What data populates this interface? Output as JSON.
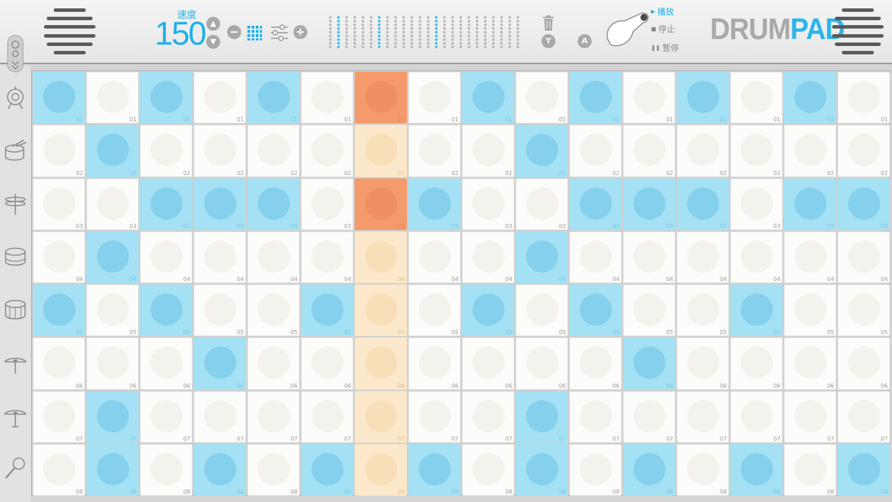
{
  "header": {
    "tempo_label": "速度",
    "tempo_value": "150",
    "tempo_up_icon": "▲",
    "tempo_down_icon": "▼",
    "minus_icon": "−",
    "plus_icon": "+",
    "y_label": "Y",
    "a_label": "A",
    "transport": {
      "play": "播放",
      "stop": "停止",
      "pause": "暂停",
      "active": "play"
    },
    "logo": {
      "part1": "DRUM",
      "part2": "PAD"
    }
  },
  "icons": {
    "left_speaker": "speaker-grille-icon",
    "right_speaker": "speaker-grille-icon",
    "pattern": "grid-icon",
    "mixer": "sliders-icon",
    "level_meter": "level-meter-icon",
    "trash": "trash-icon",
    "lever": "joystick-lever-icon",
    "kit_toggle": "kit-toggle-icon"
  },
  "colors": {
    "accent": "#1fb1ea",
    "active_pad": "#a4e1f5",
    "active_pad_dot": "#85d0ec",
    "playhead_pad": "#fce8cb",
    "playhead_active_pad": "#f49a6b",
    "idle_pad": "#fcfcfa",
    "logo_gray": "#a9a9a9"
  },
  "sequencer": {
    "steps": 16,
    "current_step": 7,
    "tracks": [
      {
        "icon": "gong-icon",
        "label": "01",
        "steps": [
          1,
          0,
          1,
          0,
          1,
          0,
          1,
          0,
          1,
          0,
          1,
          0,
          1,
          0,
          1,
          0
        ]
      },
      {
        "icon": "snare-drum-icon",
        "label": "02",
        "steps": [
          0,
          1,
          0,
          0,
          0,
          0,
          0,
          0,
          0,
          1,
          0,
          0,
          0,
          0,
          0,
          0
        ]
      },
      {
        "icon": "hihat-icon",
        "label": "03",
        "steps": [
          0,
          0,
          1,
          1,
          1,
          0,
          1,
          1,
          0,
          0,
          1,
          1,
          1,
          0,
          1,
          1
        ]
      },
      {
        "icon": "tom-drum-icon",
        "label": "04",
        "steps": [
          0,
          1,
          0,
          0,
          0,
          0,
          0,
          0,
          0,
          1,
          0,
          0,
          0,
          0,
          0,
          0
        ]
      },
      {
        "icon": "floor-tom-icon",
        "label": "05",
        "steps": [
          1,
          0,
          1,
          0,
          0,
          1,
          0,
          0,
          1,
          0,
          1,
          0,
          0,
          1,
          0,
          0
        ]
      },
      {
        "icon": "cymbal-icon",
        "label": "06",
        "steps": [
          0,
          0,
          0,
          1,
          0,
          0,
          0,
          0,
          0,
          0,
          0,
          1,
          0,
          0,
          0,
          0
        ]
      },
      {
        "icon": "ride-cymbal-icon",
        "label": "07",
        "steps": [
          0,
          1,
          0,
          0,
          0,
          0,
          0,
          0,
          0,
          1,
          0,
          0,
          0,
          0,
          0,
          0
        ]
      },
      {
        "icon": "maraca-icon",
        "label": "08",
        "steps": [
          0,
          1,
          0,
          1,
          0,
          1,
          0,
          1,
          0,
          1,
          0,
          1,
          0,
          1,
          0,
          1
        ]
      }
    ]
  }
}
